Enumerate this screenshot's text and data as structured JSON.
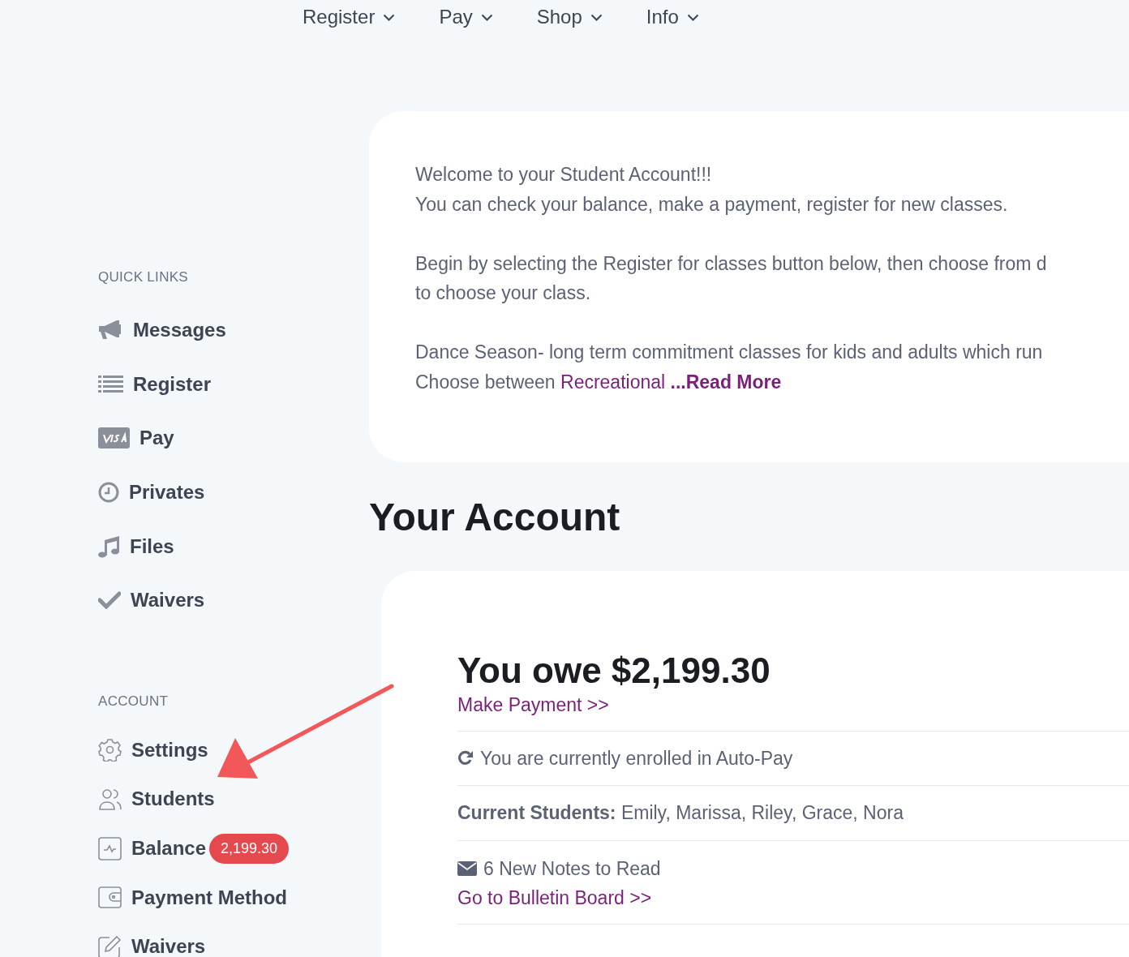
{
  "nav": [
    {
      "label": "Register"
    },
    {
      "label": "Pay"
    },
    {
      "label": "Shop"
    },
    {
      "label": "Info"
    }
  ],
  "sidebar": [
    {
      "heading": "QUICK LINKS",
      "items": [
        {
          "label": "Messages"
        },
        {
          "label": "Register"
        },
        {
          "label": "Pay"
        },
        {
          "label": "Privates"
        },
        {
          "label": "Files"
        },
        {
          "label": "Waivers"
        }
      ]
    },
    {
      "heading": "ACCOUNT",
      "items": [
        {
          "label": "Settings"
        },
        {
          "label": "Students"
        },
        {
          "label": "Balance",
          "badge": "2,199.30"
        },
        {
          "label": "Payment Method"
        },
        {
          "label": "Waivers"
        }
      ]
    }
  ],
  "welcome": {
    "paragraphs": [
      {
        "lines": [
          "Welcome to your Student Account!!!",
          "You can check your balance, make a payment, register for new classes."
        ]
      },
      {
        "lines": [
          "Begin by selecting the Register for classes button below, then choose from d",
          "to choose your class."
        ]
      },
      {
        "lines": [
          "Dance Season- long term commitment classes for kids and adults which run",
          "Choose between"
        ],
        "links": [
          {
            "label": "Recreational",
            "kind": "plain"
          },
          {
            "label": "...Read More",
            "kind": "bold"
          }
        ]
      }
    ]
  },
  "account": {
    "title": "Your Account",
    "owe": "You owe $2,199.30",
    "pay_link": "Make Payment >>",
    "autopay": "You are currently enrolled in Auto-Pay",
    "students": "**Current Students:** Emily, Marissa, Riley, Grace, Nora",
    "notes": "6 New Notes to Read",
    "bulletin_link": "Go to Bulletin Board >>"
  }
}
